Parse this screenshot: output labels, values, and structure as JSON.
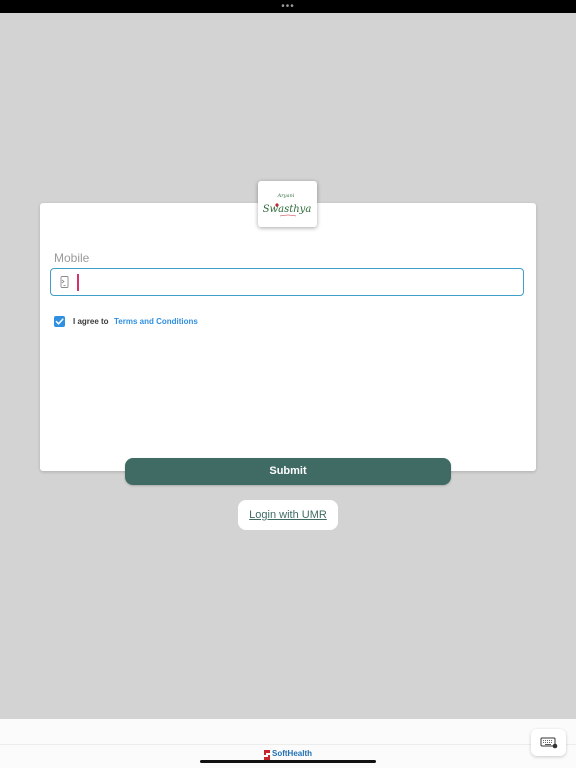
{
  "status_bar": {
    "dots": "•••"
  },
  "logo": {
    "brand_line1": "Aryani",
    "brand_line2": "Swasthya"
  },
  "form": {
    "mobile_label": "Mobile",
    "mobile_value": "",
    "mobile_placeholder": "",
    "terms_checked": true,
    "agree_text": "I agree to",
    "terms_link": "Terms and Conditions",
    "submit_label": "Submit"
  },
  "alt_login": {
    "label": "Login with UMR"
  },
  "footer": {
    "brand": "SoftHealth"
  },
  "icons": {
    "phone": "mobile-phone-icon",
    "check": "checkmark-icon",
    "keyboard": "keyboard-icon"
  },
  "colors": {
    "background": "#d3d3d3",
    "primary_button": "#3f6b64",
    "input_border": "#3f9fc7",
    "checkbox": "#2f8fe0",
    "link": "#2f8fe0",
    "caret": "#d6336c",
    "brand_red": "#c4262e",
    "brand_green": "#2f6b3b"
  }
}
